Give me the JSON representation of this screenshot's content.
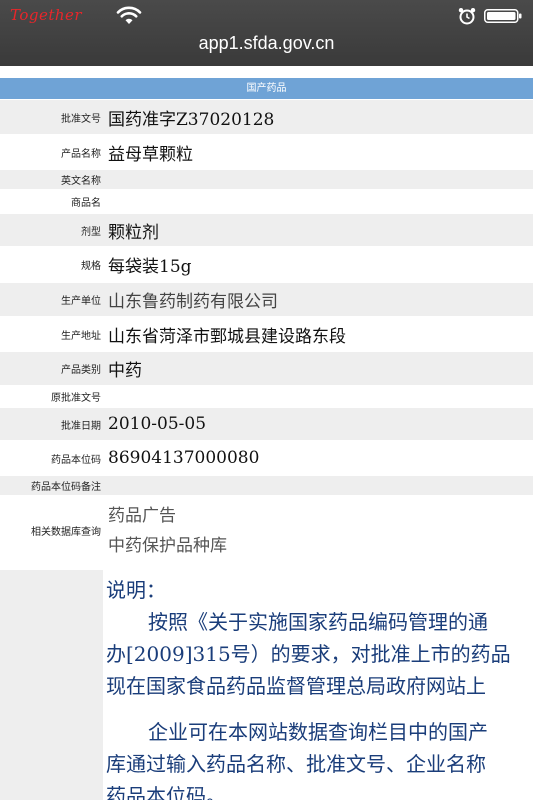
{
  "status_bar": {
    "carrier": "Together",
    "url": "app1.sfda.gov.cn"
  },
  "section": {
    "title": "国产药品"
  },
  "rows": [
    {
      "label": "批准文号",
      "value": "国药准字Z37020128"
    },
    {
      "label": "产品名称",
      "value": "益母草颗粒"
    },
    {
      "label": "英文名称",
      "value": ""
    },
    {
      "label": "商品名",
      "value": ""
    },
    {
      "label": "剂型",
      "value": "颗粒剂"
    },
    {
      "label": "规格",
      "value": "每袋装15g"
    },
    {
      "label": "生产单位",
      "value": "山东鲁药制药有限公司"
    },
    {
      "label": "生产地址",
      "value": "山东省菏泽市鄄城县建设路东段"
    },
    {
      "label": "产品类别",
      "value": "中药"
    },
    {
      "label": "原批准文号",
      "value": ""
    },
    {
      "label": "批准日期",
      "value": "2010-05-05"
    },
    {
      "label": "药品本位码",
      "value": "86904137000080"
    },
    {
      "label": "药品本位码备注",
      "value": ""
    },
    {
      "label": "相关数据库查询",
      "links": [
        "药品广告",
        "中药保护品种库"
      ]
    }
  ],
  "notice": {
    "title": "说明：",
    "line1": "按照《关于实施国家药品编码管理的通",
    "line2": "办[2009]315号）的要求，对批准上市的药品",
    "line3": "现在国家食品药品监督管理总局政府网站上",
    "line4": "企业可在本网站数据查询栏目中的国产",
    "line5": "库通过输入药品名称、批准文号、企业名称",
    "line6": "药品本位码。"
  }
}
